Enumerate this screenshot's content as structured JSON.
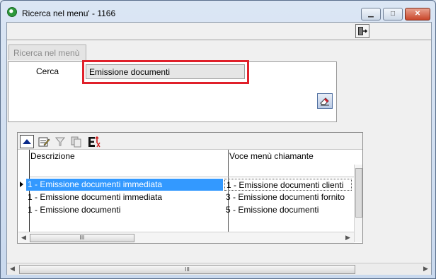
{
  "window": {
    "title": "Ricerca nel menu' - 1166",
    "minimize_glyph": "▁",
    "maximize_glyph": "□",
    "close_glyph": "✕"
  },
  "tab": {
    "label": "Ricerca nel menù"
  },
  "search": {
    "label": "Cerca",
    "value": "Emissione documenti"
  },
  "grid": {
    "columns": [
      "Descrizione",
      "Voce menù chiamante"
    ],
    "rows": [
      [
        "1 - Emissione documenti immediata",
        "1 - Emissione documenti clienti"
      ],
      [
        "1 - Emissione documenti immediata",
        "3 - Emissione documenti fornito"
      ],
      [
        "1 - Emissione documenti",
        "5 - Emissione documenti"
      ]
    ],
    "selected_row": 0,
    "scroll_thumb_glyph": "III"
  },
  "icons": {
    "app": "app-icon",
    "exit": "exit-door-icon",
    "clear": "clear-search-icon",
    "sort_up": "arrow-up-icon",
    "export": "export-excel-icon",
    "filter": "filter-icon",
    "copy": "copy-icon",
    "edit": "edit-icon"
  },
  "colors": {
    "highlight_border": "#e0202a",
    "selection": "#3399ff"
  }
}
